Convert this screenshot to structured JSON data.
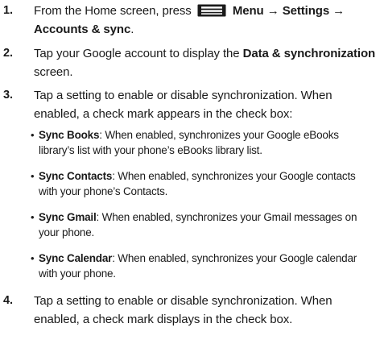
{
  "steps": [
    {
      "number": "1.",
      "pre": "From the Home screen, press",
      "icon": "menu-icon",
      "menu": "Menu",
      "arrow1": "→",
      "settings": "Settings",
      "arrow2": "→",
      "accounts": "Accounts & sync",
      "end": "."
    },
    {
      "number": "2.",
      "pre": "Tap your Google account to display the ",
      "bold": "Data & synchronization",
      "post": " screen."
    },
    {
      "number": "3.",
      "line1": "Tap a setting to enable or disable synchronization. When",
      "line2": "enabled, a check mark appears in the check box:",
      "bullets": [
        {
          "symbol": "•",
          "label": "Sync Books",
          "text": ": When enabled, synchronizes your Google eBooks library’s list with your phone’s eBooks library list."
        },
        {
          "symbol": "•",
          "label": "Sync Contacts",
          "text": ": When enabled, synchronizes your Google contacts with your phone’s Contacts."
        },
        {
          "symbol": "•",
          "label": "Sync Gmail",
          "text": ": When enabled, synchronizes your Gmail messages on your phone."
        },
        {
          "symbol": "•",
          "label": "Sync Calendar",
          "text": ": When enabled, synchronizes your Google calendar with your phone."
        }
      ]
    },
    {
      "number": "4.",
      "line1": "Tap a setting to enable or disable synchronization. When",
      "line2": "enabled, a check mark displays in the check box."
    }
  ]
}
